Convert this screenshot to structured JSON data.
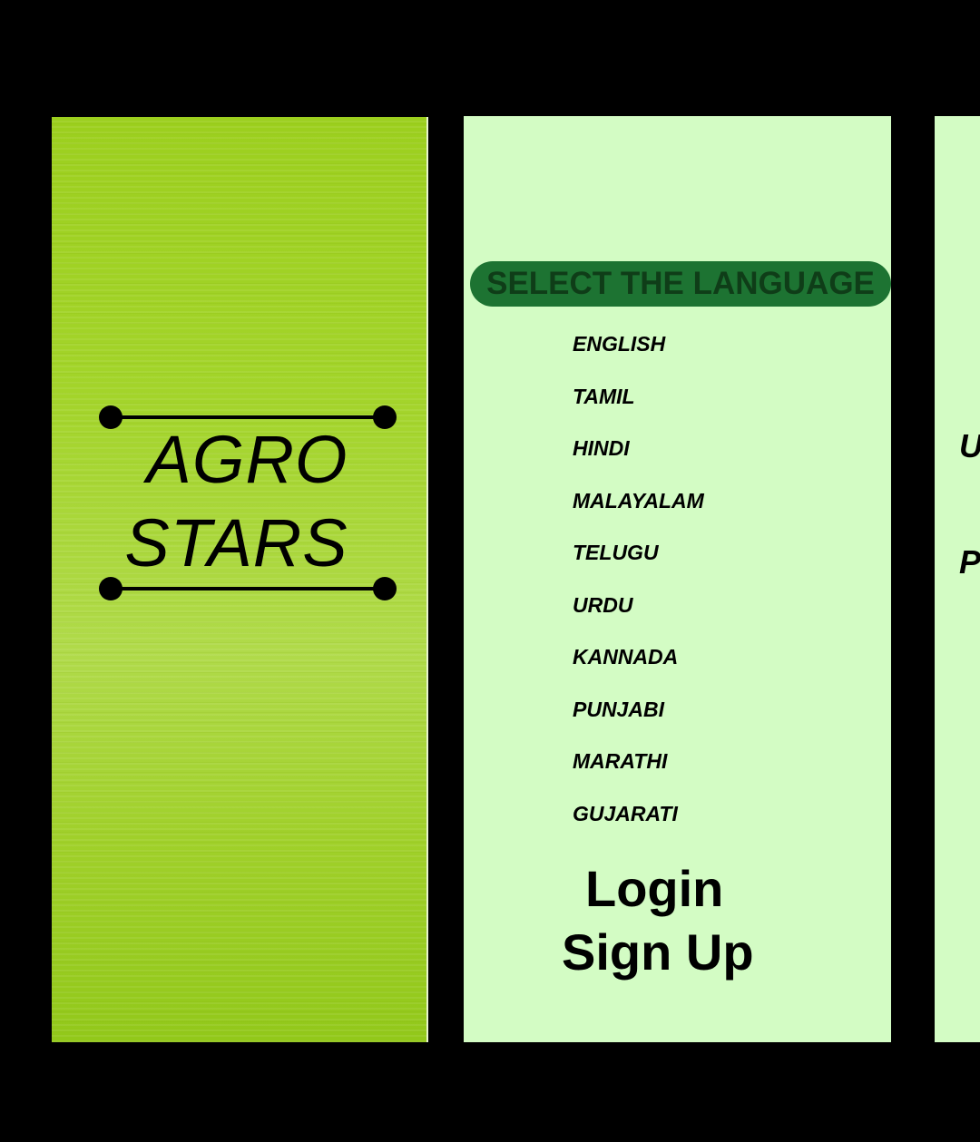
{
  "splash": {
    "brand_line_1": "AGRO",
    "brand_line_2": "STARS",
    "background_color": "#a3d42a"
  },
  "language_screen": {
    "header": "SELECT THE LANGUAGE",
    "header_color": "#1d7332",
    "background_color": "#d3fcc4",
    "languages": [
      "ENGLISH",
      "TAMIL",
      "HINDI",
      "MALAYALAM",
      "TELUGU",
      "URDU",
      "KANNADA",
      "PUNJABI",
      "MARATHI",
      "GUJARATI"
    ],
    "login_label": "Login",
    "signup_label": "Sign Up"
  },
  "partial_screen": {
    "text_1": "U",
    "text_2": "P"
  }
}
